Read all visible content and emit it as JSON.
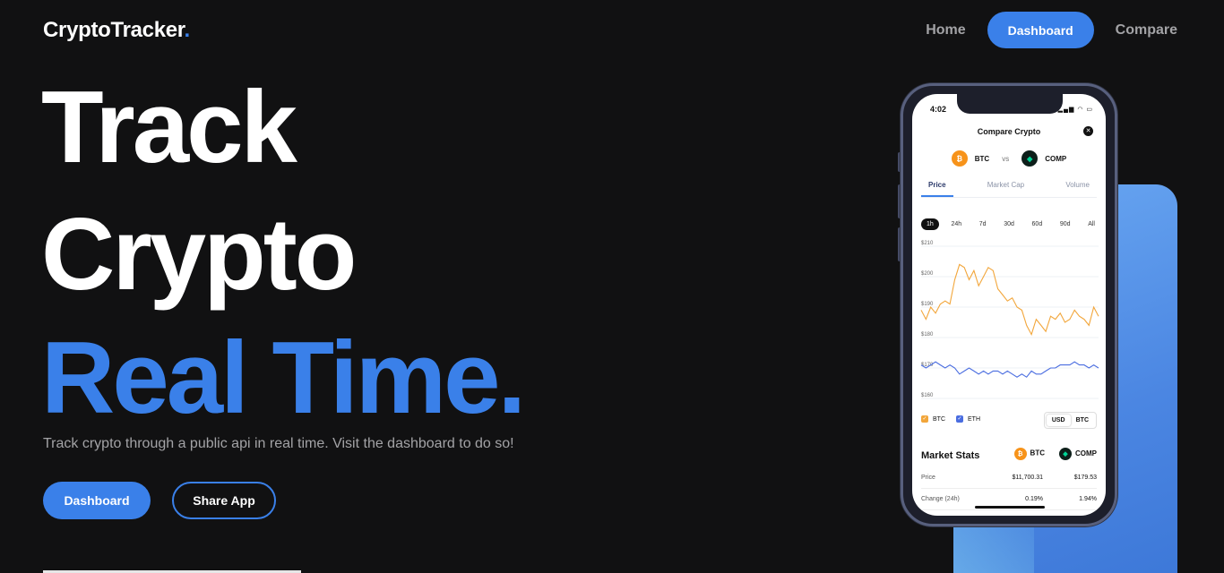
{
  "brand": {
    "name": "CryptoTracker",
    "dot": "."
  },
  "nav": {
    "home": "Home",
    "dashboard": "Dashboard",
    "compare": "Compare"
  },
  "hero": {
    "line1": "Track",
    "line2": "Crypto",
    "line3": "Real Time.",
    "subtitle": "Track crypto through a public api in real time. Visit the dashboard to do so!",
    "primary_button": "Dashboard",
    "secondary_button": "Share App"
  },
  "colors": {
    "accent": "#3a80e9",
    "background": "#111112",
    "muted": "#a3a3a6"
  },
  "phone": {
    "time": "4:02",
    "title": "Compare Crypto",
    "coin_a": "BTC",
    "vs": "vs",
    "coin_b": "COMP",
    "tabs": [
      "Price",
      "Market Cap",
      "Volume"
    ],
    "ranges": [
      "1h",
      "24h",
      "7d",
      "30d",
      "60d",
      "90d",
      "All"
    ],
    "legend": {
      "btc": "BTC",
      "eth": "ETH"
    },
    "currency": [
      "USD",
      "BTC"
    ],
    "market_stats": {
      "title": "Market Stats",
      "col_a": "BTC",
      "col_b": "COMP",
      "rows": [
        {
          "label": "Price",
          "a": "$11,700.31",
          "b": "$179.53"
        },
        {
          "label": "Change (24h)",
          "a": "0.19%",
          "b": "1.94%"
        }
      ]
    }
  },
  "chart_data": {
    "type": "line",
    "y_ticks": [
      "$210",
      "$200",
      "$190",
      "$180",
      "$170",
      "$160"
    ],
    "ylim": [
      160,
      210
    ],
    "series": [
      {
        "name": "BTC",
        "color": "#f2a63b",
        "values": [
          189,
          186,
          190,
          188,
          191,
          192,
          191,
          199,
          204,
          203,
          199,
          202,
          197,
          200,
          203,
          202,
          196,
          194,
          192,
          193,
          190,
          189,
          184,
          181,
          186,
          184,
          182,
          187,
          186,
          188,
          185,
          186,
          189,
          187,
          186,
          184,
          190,
          187
        ]
      },
      {
        "name": "ETH",
        "color": "#4a6de0",
        "values": [
          171,
          170,
          171,
          172,
          171,
          170,
          171,
          170,
          168,
          169,
          170,
          169,
          168,
          169,
          168,
          169,
          169,
          168,
          169,
          168,
          167,
          168,
          167,
          169,
          168,
          168,
          169,
          170,
          170,
          171,
          171,
          171,
          172,
          171,
          171,
          170,
          171,
          170
        ]
      }
    ]
  }
}
